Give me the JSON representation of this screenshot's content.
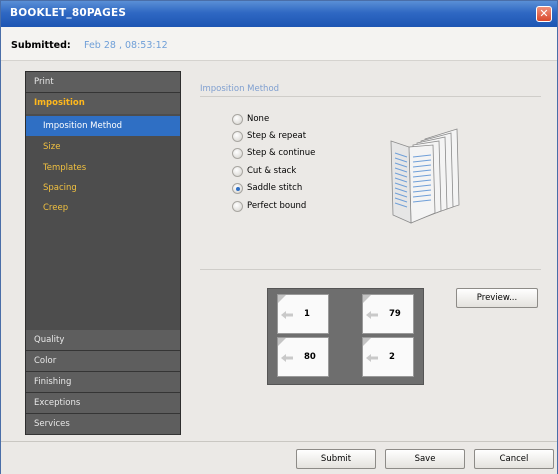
{
  "window": {
    "title": "BOOKLET_80PAGES"
  },
  "submitted": {
    "label": "Submitted:",
    "value": "Feb 28 , 08:53:12"
  },
  "sidebar": {
    "top_items": [
      {
        "label": "Print"
      }
    ],
    "active_section": {
      "label": "Imposition"
    },
    "sub_items": [
      {
        "label": "Imposition Method",
        "selected": true
      },
      {
        "label": "Size"
      },
      {
        "label": "Templates"
      },
      {
        "label": "Spacing"
      },
      {
        "label": "Creep"
      }
    ],
    "bottom_items": [
      {
        "label": "Quality"
      },
      {
        "label": "Color"
      },
      {
        "label": "Finishing"
      },
      {
        "label": "Exceptions"
      },
      {
        "label": "Services"
      }
    ]
  },
  "content": {
    "section_title": "Imposition Method",
    "options": [
      {
        "label": "None",
        "checked": false
      },
      {
        "label": "Step & repeat",
        "checked": false
      },
      {
        "label": "Step & continue",
        "checked": false
      },
      {
        "label": "Cut & stack",
        "checked": false
      },
      {
        "label": "Saddle stitch",
        "checked": true
      },
      {
        "label": "Perfect bound",
        "checked": false
      }
    ],
    "layout_pages": [
      "1",
      "79",
      "80",
      "2"
    ],
    "preview_label": "Preview..."
  },
  "footer": {
    "submit_label": "Submit",
    "save_label": "Save",
    "cancel_label": "Cancel"
  },
  "colors": {
    "accent": "#2f6fc4",
    "section_highlight": "#ffb81c",
    "subitem_text": "#f0c040",
    "title_bar": "#2f68c3"
  },
  "icons": {
    "close": "close-icon",
    "booklet": "booklet-icon",
    "page_arrow": "arrow-left-icon"
  }
}
